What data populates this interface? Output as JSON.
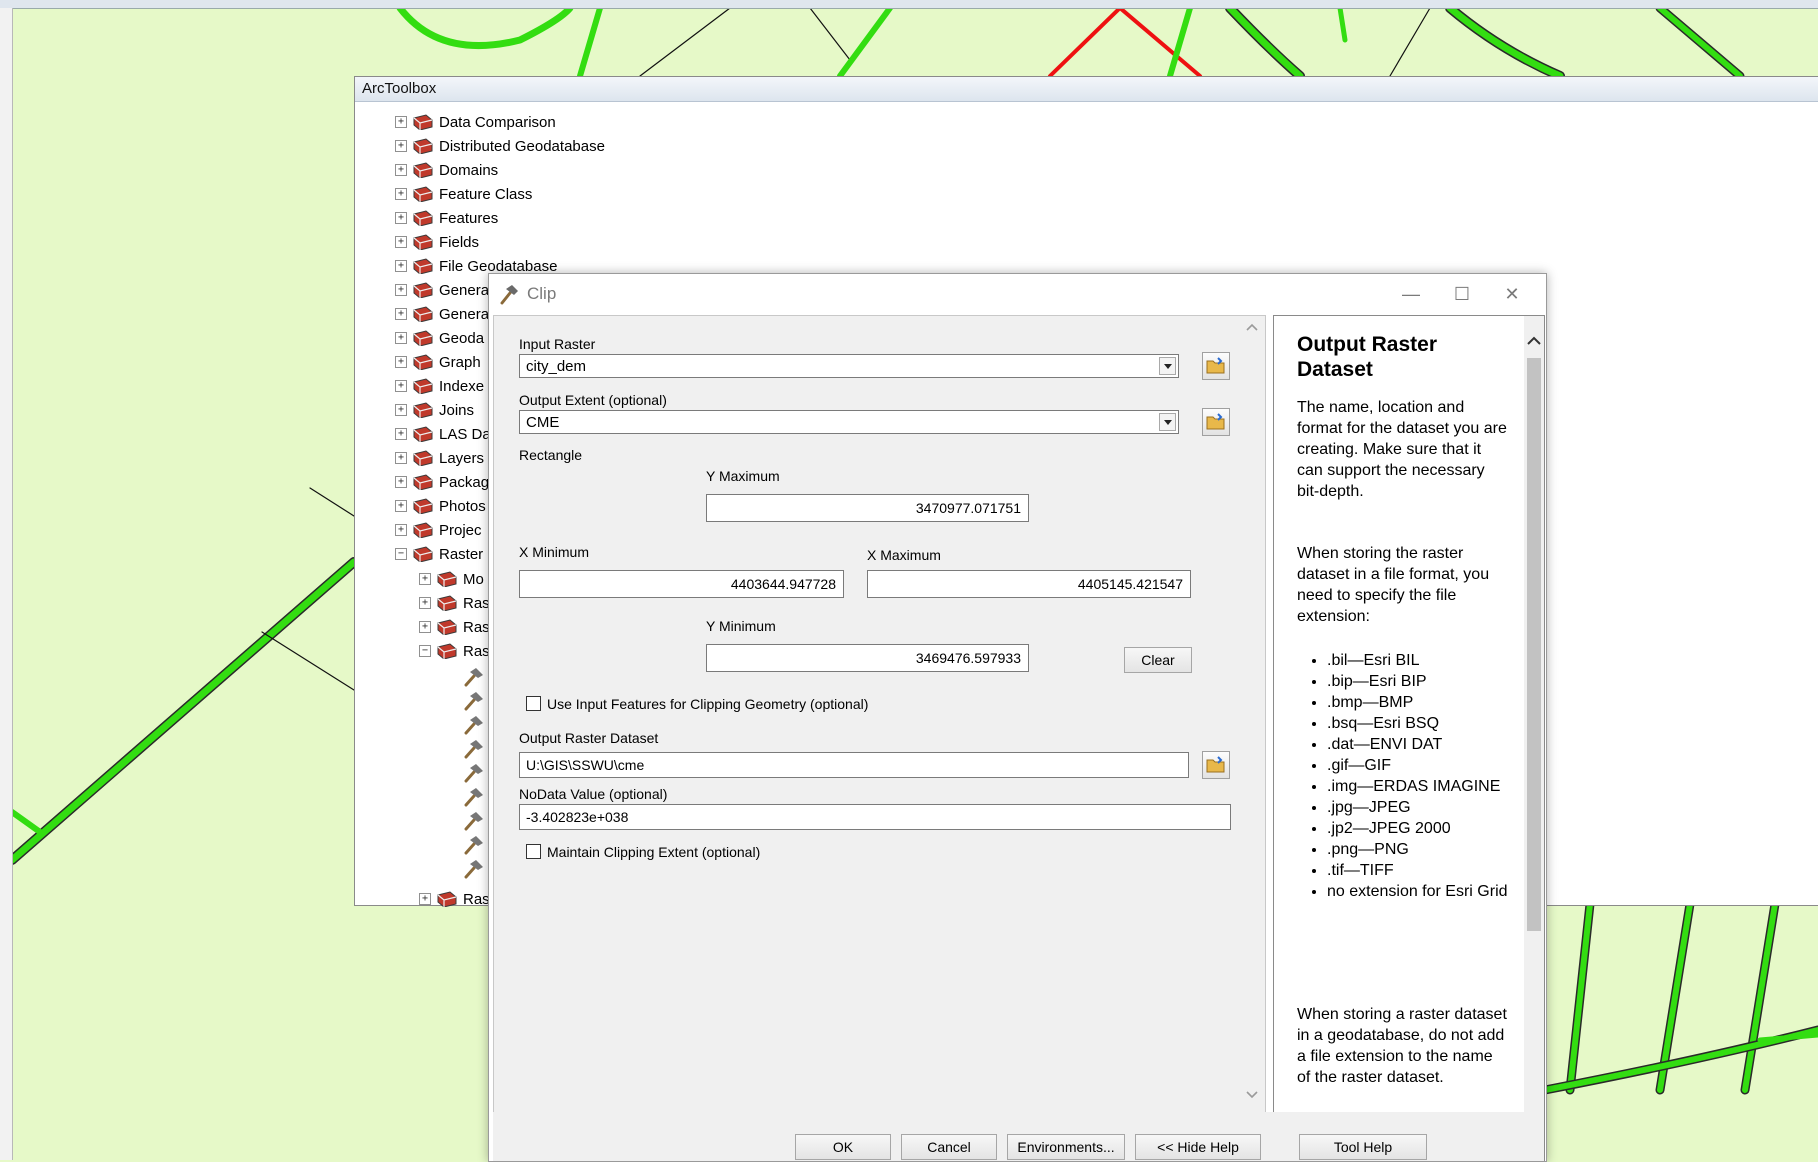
{
  "toolbox": {
    "title": "ArcToolbox",
    "items": [
      {
        "label": "Data Comparison",
        "expand": "+"
      },
      {
        "label": "Distributed Geodatabase",
        "expand": "+"
      },
      {
        "label": "Domains",
        "expand": "+"
      },
      {
        "label": "Feature Class",
        "expand": "+"
      },
      {
        "label": "Features",
        "expand": "+"
      },
      {
        "label": "Fields",
        "expand": "+"
      },
      {
        "label": "File Geodatabase",
        "expand": "+"
      },
      {
        "label": "Genera",
        "expand": "+"
      },
      {
        "label": "Genera",
        "expand": "+"
      },
      {
        "label": "Geoda",
        "expand": "+"
      },
      {
        "label": "Graph",
        "expand": "+"
      },
      {
        "label": "Indexe",
        "expand": "+"
      },
      {
        "label": "Joins",
        "expand": "+"
      },
      {
        "label": "LAS Da",
        "expand": "+"
      },
      {
        "label": "Layers",
        "expand": "+"
      },
      {
        "label": "Packag",
        "expand": "+"
      },
      {
        "label": "Photos",
        "expand": "+"
      },
      {
        "label": "Projec",
        "expand": "+"
      },
      {
        "label": "Raster",
        "expand": "−"
      }
    ],
    "sub_items": [
      {
        "label": "Mo",
        "expand": "+"
      },
      {
        "label": "Ras",
        "expand": "+"
      },
      {
        "label": "Ras",
        "expand": "+"
      },
      {
        "label": "Ras",
        "expand": "−"
      }
    ],
    "last_item": {
      "label": "Ras",
      "expand": "+"
    }
  },
  "dialog": {
    "title": "Clip",
    "input_raster_label": "Input Raster",
    "input_raster_value": "city_dem",
    "output_extent_label": "Output Extent (optional)",
    "output_extent_value": "CME",
    "rectangle_label": "Rectangle",
    "y_max_label": "Y Maximum",
    "y_max_value": "3470977.071751",
    "x_min_label": "X Minimum",
    "x_min_value": "4403644.947728",
    "x_max_label": "X Maximum",
    "x_max_value": "4405145.421547",
    "y_min_label": "Y Minimum",
    "y_min_value": "3469476.597933",
    "clear_label": "Clear",
    "use_input_features_label": "Use Input Features for Clipping Geometry (optional)",
    "output_raster_label": "Output Raster Dataset",
    "output_raster_value": "U:\\GIS\\SSWU\\cme",
    "nodata_label": "NoData Value (optional)",
    "nodata_value": "-3.402823e+038",
    "maintain_extent_label": "Maintain Clipping Extent (optional)",
    "buttons": {
      "ok": "OK",
      "cancel": "Cancel",
      "environments": "Environments...",
      "hide_help": "<< Hide Help",
      "tool_help": "Tool Help"
    }
  },
  "help": {
    "title": "Output Raster Dataset",
    "para1": "The name, location and format for the dataset you are creating. Make sure that it can support the necessary bit-depth.",
    "para2": "When storing the raster dataset in a file format, you need to specify the file extension:",
    "extensions": [
      ".bil—Esri BIL",
      ".bip—Esri BIP",
      ".bmp—BMP",
      ".bsq—Esri BSQ",
      ".dat—ENVI DAT",
      ".gif—GIF",
      ".img—ERDAS IMAGINE",
      ".jpg—JPEG",
      ".jp2—JPEG 2000",
      ".png—PNG",
      ".tif—TIFF",
      "no extension for Esri Grid"
    ],
    "para3": "When storing a raster dataset in a geodatabase, do not add a file extension to the name of the raster dataset."
  },
  "colors": {
    "map_background": "#e6f9c8",
    "road_green": "#33dd11",
    "road_red": "#ee1111"
  }
}
